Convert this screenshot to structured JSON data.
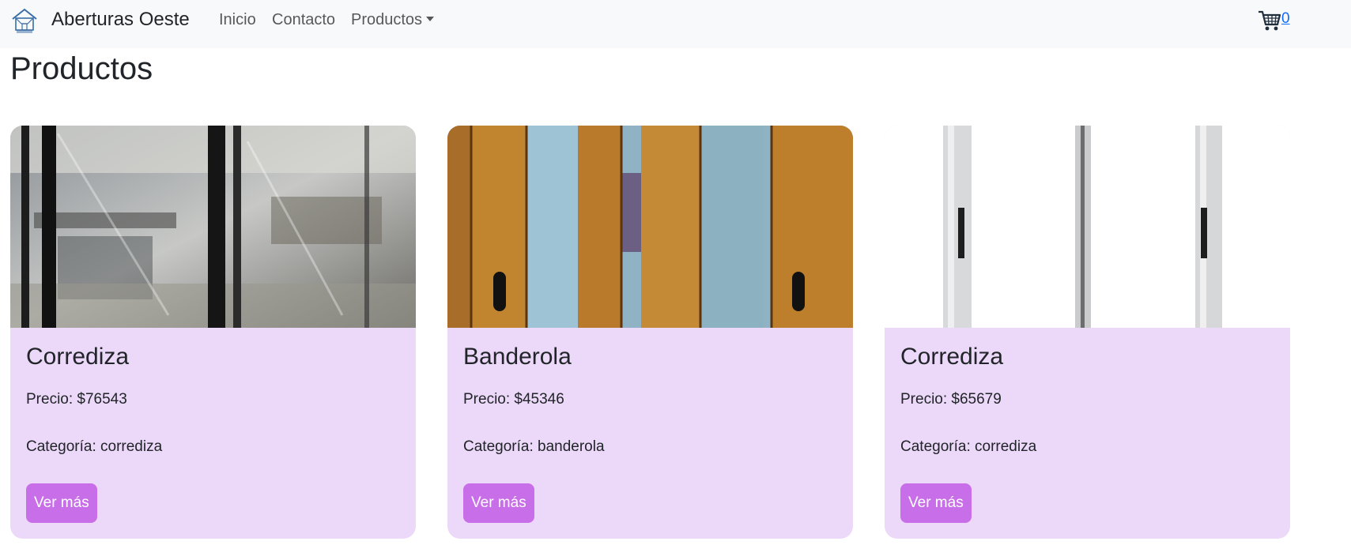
{
  "navbar": {
    "brand": "Aberturas Oeste",
    "links": [
      {
        "label": "Inicio"
      },
      {
        "label": "Contacto"
      },
      {
        "label": "Productos"
      }
    ],
    "cart_count": "0"
  },
  "main": {
    "title": "Productos"
  },
  "products": [
    {
      "name": "Corrediza",
      "price": "Precio: $76543",
      "category": "Categoría: corrediza",
      "button": "Ver más",
      "image_icon": "sliding-glass-door-photo"
    },
    {
      "name": "Banderola",
      "price": "Precio: $45346",
      "category": "Categoría: banderola",
      "button": "Ver más",
      "image_icon": "wooden-window-photo"
    },
    {
      "name": "Corrediza",
      "price": "Precio: $65679",
      "category": "Categoría: corrediza",
      "button": "Ver más",
      "image_icon": "white-aluminum-window-photo"
    }
  ],
  "colors": {
    "navbar_bg": "#f8f9fa",
    "card_bg": "#ecd8f8",
    "button_bg": "#c86ee8",
    "link": "#0d6efd"
  }
}
